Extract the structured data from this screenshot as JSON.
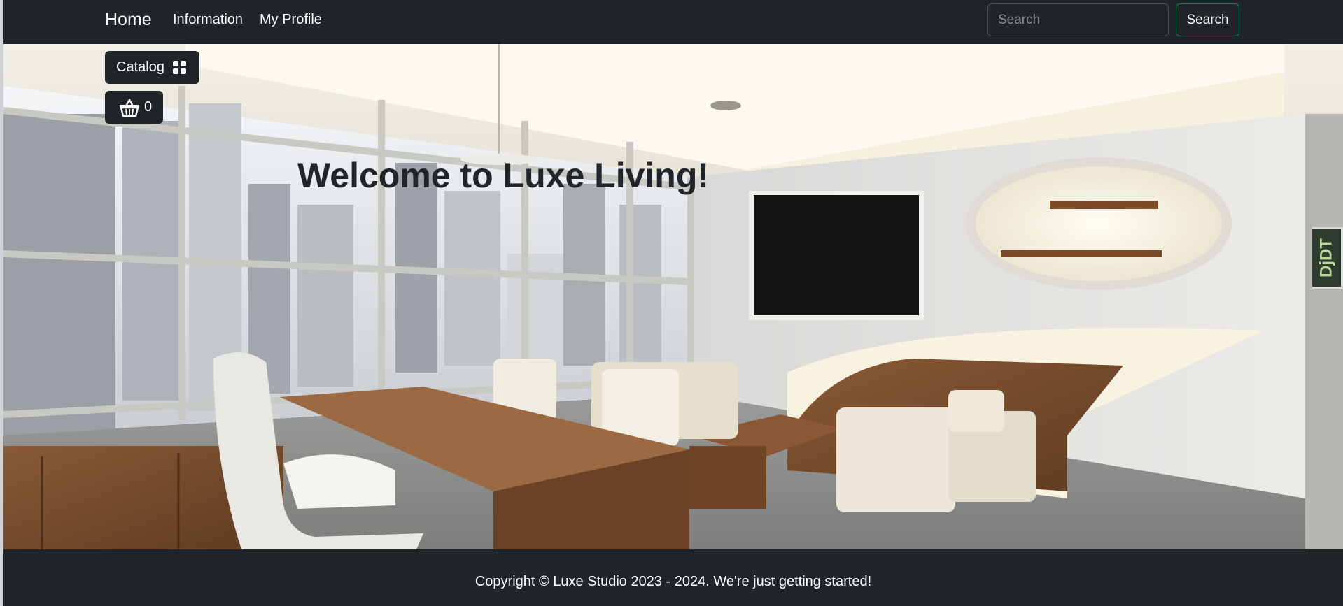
{
  "navbar": {
    "brand": "Home",
    "links": [
      "Information",
      "My Profile"
    ],
    "search": {
      "placeholder": "Search",
      "value": "",
      "button_label": "Search"
    }
  },
  "sidebar": {
    "catalog_label": "Catalog",
    "cart_count": "0"
  },
  "hero": {
    "heading": "Welcome to Luxe Living!"
  },
  "debug_toolbar": {
    "label": "DjDT"
  },
  "footer": {
    "text": "Copyright © Luxe Studio 2023 - 2024. We're just getting started!"
  },
  "colors": {
    "navbar_bg": "#212529",
    "search_button_border": "#198754",
    "text_light": "#ffffff"
  }
}
